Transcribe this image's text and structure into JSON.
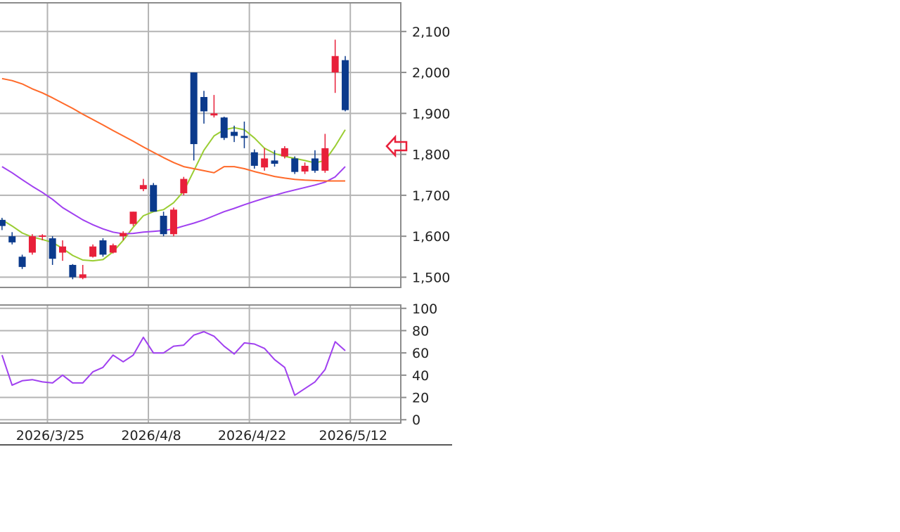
{
  "colors": {
    "up_candle": "#e8203a",
    "down_candle": "#0b3a8c",
    "ma_short": "#9acd32",
    "ma_mid": "#a040f0",
    "ma_long": "#ff6a2a",
    "oscillator": "#a040f0",
    "current_price_marker": "#e8203a"
  },
  "chart_data": [
    {
      "type": "candlestick",
      "panel": "price",
      "y_ticks": [
        "1,500",
        "1,600",
        "1,700",
        "1,800",
        "1,900",
        "2,000",
        "2,100"
      ],
      "y_tick_values": [
        1500,
        1600,
        1700,
        1800,
        1900,
        2000,
        2100
      ],
      "ylim": [
        1475,
        2170
      ],
      "x_tick_labels": [
        "2026/3/25",
        "2026/4/8",
        "2026/4/22",
        "2026/5/12"
      ],
      "x_tick_indices": [
        4.5,
        14.5,
        24.5,
        34.5
      ],
      "x_index_range": [
        -0.2,
        39.5
      ],
      "grid": true,
      "candles": [
        {
          "i": 0,
          "o": 1640,
          "h": 1645,
          "l": 1615,
          "c": 1625
        },
        {
          "i": 1,
          "o": 1600,
          "h": 1610,
          "l": 1580,
          "c": 1585
        },
        {
          "i": 2,
          "o": 1550,
          "h": 1555,
          "l": 1520,
          "c": 1525
        },
        {
          "i": 3,
          "o": 1560,
          "h": 1605,
          "l": 1555,
          "c": 1600
        },
        {
          "i": 4,
          "o": 1600,
          "h": 1605,
          "l": 1590,
          "c": 1602
        },
        {
          "i": 5,
          "o": 1595,
          "h": 1600,
          "l": 1530,
          "c": 1545
        },
        {
          "i": 6,
          "o": 1560,
          "h": 1590,
          "l": 1540,
          "c": 1575
        },
        {
          "i": 7,
          "o": 1530,
          "h": 1532,
          "l": 1495,
          "c": 1500
        },
        {
          "i": 8,
          "o": 1498,
          "h": 1530,
          "l": 1495,
          "c": 1507
        },
        {
          "i": 9,
          "o": 1550,
          "h": 1580,
          "l": 1548,
          "c": 1575
        },
        {
          "i": 10,
          "o": 1590,
          "h": 1595,
          "l": 1550,
          "c": 1555
        },
        {
          "i": 11,
          "o": 1560,
          "h": 1582,
          "l": 1558,
          "c": 1578
        },
        {
          "i": 12,
          "o": 1600,
          "h": 1612,
          "l": 1590,
          "c": 1608
        },
        {
          "i": 13,
          "o": 1630,
          "h": 1660,
          "l": 1625,
          "c": 1660
        },
        {
          "i": 14,
          "o": 1715,
          "h": 1740,
          "l": 1710,
          "c": 1725
        },
        {
          "i": 15,
          "o": 1725,
          "h": 1730,
          "l": 1660,
          "c": 1660
        },
        {
          "i": 16,
          "o": 1650,
          "h": 1660,
          "l": 1600,
          "c": 1605
        },
        {
          "i": 17,
          "o": 1605,
          "h": 1670,
          "l": 1600,
          "c": 1665
        },
        {
          "i": 18,
          "o": 1705,
          "h": 1745,
          "l": 1700,
          "c": 1740
        },
        {
          "i": 19,
          "o": 2000,
          "h": 2000,
          "l": 1785,
          "c": 1825
        },
        {
          "i": 20,
          "o": 1940,
          "h": 1955,
          "l": 1875,
          "c": 1905
        },
        {
          "i": 21,
          "o": 1895,
          "h": 1945,
          "l": 1890,
          "c": 1900
        },
        {
          "i": 22,
          "o": 1890,
          "h": 1892,
          "l": 1835,
          "c": 1840
        },
        {
          "i": 23,
          "o": 1855,
          "h": 1870,
          "l": 1830,
          "c": 1845
        },
        {
          "i": 24,
          "o": 1845,
          "h": 1880,
          "l": 1815,
          "c": 1840
        },
        {
          "i": 25,
          "o": 1805,
          "h": 1812,
          "l": 1765,
          "c": 1772
        },
        {
          "i": 26,
          "o": 1768,
          "h": 1815,
          "l": 1760,
          "c": 1790
        },
        {
          "i": 27,
          "o": 1785,
          "h": 1810,
          "l": 1770,
          "c": 1777
        },
        {
          "i": 28,
          "o": 1795,
          "h": 1820,
          "l": 1790,
          "c": 1815
        },
        {
          "i": 29,
          "o": 1790,
          "h": 1795,
          "l": 1752,
          "c": 1757
        },
        {
          "i": 30,
          "o": 1758,
          "h": 1780,
          "l": 1752,
          "c": 1772
        },
        {
          "i": 31,
          "o": 1790,
          "h": 1810,
          "l": 1755,
          "c": 1760
        },
        {
          "i": 32,
          "o": 1760,
          "h": 1850,
          "l": 1755,
          "c": 1815
        },
        {
          "i": 33,
          "o": 2000,
          "h": 2080,
          "l": 1950,
          "c": 2040
        },
        {
          "i": 34,
          "o": 2030,
          "h": 2040,
          "l": 1905,
          "c": 1908
        }
      ],
      "moving_averages": [
        {
          "key": "ma_short",
          "points": [
            [
              0,
              1640
            ],
            [
              1,
              1625
            ],
            [
              2,
              1608
            ],
            [
              3,
              1598
            ],
            [
              4,
              1592
            ],
            [
              5,
              1585
            ],
            [
              6,
              1570
            ],
            [
              7,
              1553
            ],
            [
              8,
              1542
            ],
            [
              9,
              1540
            ],
            [
              10,
              1543
            ],
            [
              11,
              1562
            ],
            [
              12,
              1590
            ],
            [
              13,
              1622
            ],
            [
              14,
              1650
            ],
            [
              15,
              1660
            ],
            [
              16,
              1665
            ],
            [
              17,
              1682
            ],
            [
              18,
              1710
            ],
            [
              19,
              1760
            ],
            [
              20,
              1810
            ],
            [
              21,
              1845
            ],
            [
              22,
              1860
            ],
            [
              23,
              1865
            ],
            [
              24,
              1860
            ],
            [
              25,
              1840
            ],
            [
              26,
              1815
            ],
            [
              27,
              1802
            ],
            [
              28,
              1795
            ],
            [
              29,
              1790
            ],
            [
              30,
              1785
            ],
            [
              31,
              1779
            ],
            [
              32,
              1785
            ],
            [
              33,
              1820
            ],
            [
              34,
              1860
            ]
          ]
        },
        {
          "key": "ma_mid",
          "points": [
            [
              0,
              1770
            ],
            [
              1,
              1755
            ],
            [
              2,
              1738
            ],
            [
              3,
              1722
            ],
            [
              4,
              1707
            ],
            [
              5,
              1690
            ],
            [
              6,
              1670
            ],
            [
              7,
              1655
            ],
            [
              8,
              1640
            ],
            [
              9,
              1628
            ],
            [
              10,
              1618
            ],
            [
              11,
              1610
            ],
            [
              12,
              1606
            ],
            [
              13,
              1607
            ],
            [
              14,
              1610
            ],
            [
              15,
              1612
            ],
            [
              16,
              1614
            ],
            [
              17,
              1618
            ],
            [
              18,
              1625
            ],
            [
              19,
              1632
            ],
            [
              20,
              1640
            ],
            [
              21,
              1650
            ],
            [
              22,
              1660
            ],
            [
              23,
              1668
            ],
            [
              24,
              1677
            ],
            [
              25,
              1685
            ],
            [
              26,
              1693
            ],
            [
              27,
              1700
            ],
            [
              28,
              1707
            ],
            [
              29,
              1713
            ],
            [
              30,
              1719
            ],
            [
              31,
              1725
            ],
            [
              32,
              1732
            ],
            [
              33,
              1745
            ],
            [
              34,
              1770
            ]
          ]
        },
        {
          "key": "ma_long",
          "points": [
            [
              0,
              1985
            ],
            [
              1,
              1980
            ],
            [
              2,
              1972
            ],
            [
              3,
              1960
            ],
            [
              4,
              1950
            ],
            [
              5,
              1938
            ],
            [
              6,
              1925
            ],
            [
              7,
              1912
            ],
            [
              8,
              1898
            ],
            [
              9,
              1885
            ],
            [
              10,
              1872
            ],
            [
              11,
              1858
            ],
            [
              12,
              1845
            ],
            [
              13,
              1832
            ],
            [
              14,
              1818
            ],
            [
              15,
              1805
            ],
            [
              16,
              1792
            ],
            [
              17,
              1780
            ],
            [
              18,
              1770
            ],
            [
              19,
              1765
            ],
            [
              20,
              1760
            ],
            [
              21,
              1755
            ],
            [
              22,
              1770
            ],
            [
              23,
              1770
            ],
            [
              24,
              1765
            ],
            [
              25,
              1758
            ],
            [
              26,
              1752
            ],
            [
              27,
              1746
            ],
            [
              28,
              1742
            ],
            [
              29,
              1739
            ],
            [
              30,
              1737
            ],
            [
              31,
              1736
            ],
            [
              32,
              1735
            ],
            [
              33,
              1735
            ],
            [
              34,
              1735
            ]
          ]
        }
      ]
    },
    {
      "type": "line",
      "panel": "oscillator",
      "y_ticks": [
        "0",
        "20",
        "40",
        "60",
        "80",
        "100"
      ],
      "y_tick_values": [
        0,
        20,
        40,
        60,
        80,
        100
      ],
      "ylim": [
        -3,
        103
      ],
      "grid": true,
      "series": [
        {
          "key": "oscillator",
          "points": [
            [
              0,
              58
            ],
            [
              1,
              31
            ],
            [
              2,
              35
            ],
            [
              3,
              36
            ],
            [
              4,
              34
            ],
            [
              5,
              33
            ],
            [
              6,
              40
            ],
            [
              7,
              33
            ],
            [
              8,
              33
            ],
            [
              9,
              43
            ],
            [
              10,
              47
            ],
            [
              11,
              58
            ],
            [
              12,
              52
            ],
            [
              13,
              58
            ],
            [
              14,
              74
            ],
            [
              15,
              60
            ],
            [
              16,
              60
            ],
            [
              17,
              66
            ],
            [
              18,
              67
            ],
            [
              19,
              76
            ],
            [
              20,
              79
            ],
            [
              21,
              75
            ],
            [
              22,
              66
            ],
            [
              23,
              59
            ],
            [
              24,
              69
            ],
            [
              25,
              68
            ],
            [
              26,
              64
            ],
            [
              27,
              54
            ],
            [
              28,
              47
            ],
            [
              29,
              22
            ],
            [
              30,
              28
            ],
            [
              31,
              34
            ],
            [
              32,
              45
            ],
            [
              33,
              70
            ],
            [
              34,
              62
            ]
          ]
        }
      ]
    }
  ]
}
